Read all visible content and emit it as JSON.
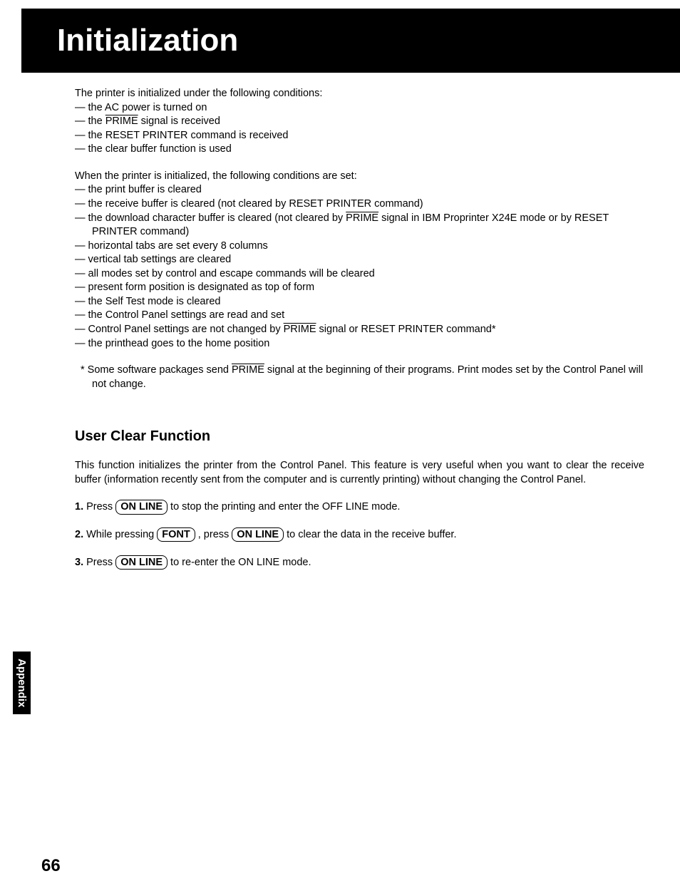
{
  "header": {
    "title": "Initialization"
  },
  "intro1": "The printer is initialized under the following conditions:",
  "conditions": {
    "i0": "the AC power is turned on",
    "i1_a": "the ",
    "i1_b": "PRIME",
    "i1_c": " signal is received",
    "i2": "the RESET PRINTER command is received",
    "i3": "the clear buffer function is used"
  },
  "intro2": "When the printer is initialized, the following conditions are set:",
  "results": {
    "r0": "the print buffer is cleared",
    "r1": "the receive buffer is cleared (not cleared by RESET PRINTER command)",
    "r2_a": "the download character buffer is cleared (not cleared by ",
    "r2_b": "PRIME",
    "r2_c": " signal in IBM Proprinter X24E mode or by RESET PRINTER command)",
    "r3": "horizontal tabs are set every 8 columns",
    "r4": "vertical tab settings are cleared",
    "r5": "all modes set by control and escape commands will be cleared",
    "r6": "present form position is designated as top of form",
    "r7": "the Self Test mode is cleared",
    "r8": "the Control Panel settings are read and set",
    "r9_a": "Control Panel settings are not changed by ",
    "r9_b": "PRIME",
    "r9_c": " signal or RESET PRINTER command*",
    "r10": "the printhead goes to the home position"
  },
  "note": {
    "prefix": "* ",
    "a": "Some software packages send ",
    "b": "PRIME",
    "c": " signal at the beginning of their programs. Print modes set by the Control Panel will not change."
  },
  "sub": {
    "heading": "User Clear Function",
    "para": "This function initializes the printer from the Control Panel. This feature is very useful when you want to clear the receive buffer (information recently sent from the computer and is currently printing) without changing the Control Panel."
  },
  "steps": {
    "s1_num": "1.",
    "s1_a": " Press ",
    "s1_key": "ON LINE",
    "s1_b": " to stop the printing and enter the OFF LINE mode.",
    "s2_num": "2.",
    "s2_a": " While pressing ",
    "s2_key1": "FONT",
    "s2_b": " , press ",
    "s2_key2": "ON LINE",
    "s2_c": " to clear the data in the receive buffer.",
    "s3_num": "3.",
    "s3_a": " Press ",
    "s3_key": "ON LINE",
    "s3_b": " to re-enter the ON LINE mode."
  },
  "sidetab": "Appendix",
  "page_number": "66"
}
